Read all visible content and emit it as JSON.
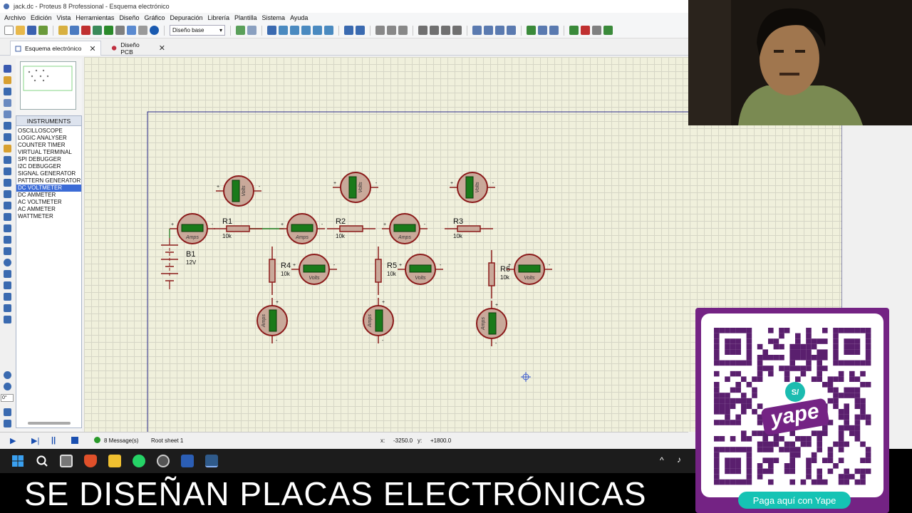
{
  "window": {
    "title": "jack.dc - Proteus 8 Professional - Esquema electrónico"
  },
  "menu": {
    "items": [
      "Archivo",
      "Edición",
      "Vista",
      "Herramientas",
      "Diseño",
      "Gráfico",
      "Depuración",
      "Librería",
      "Plantilla",
      "Sistema",
      "Ayuda"
    ]
  },
  "toolbar": {
    "variant_select": "Diseño base"
  },
  "tabs": [
    {
      "label": "Esquema electrónico",
      "active": true
    },
    {
      "label": "Diseño PCB",
      "active": false
    }
  ],
  "instruments": {
    "header": "INSTRUMENTS",
    "items": [
      "OSCILLOSCOPE",
      "LOGIC ANALYSER",
      "COUNTER TIMER",
      "VIRTUAL TERMINAL",
      "SPI DEBUGGER",
      "I2C DEBUGGER",
      "SIGNAL GENERATOR",
      "PATTERN GENERATOR",
      "DC VOLTMETER",
      "DC AMMETER",
      "AC VOLTMETER",
      "AC AMMETER",
      "WATTMETER"
    ],
    "selected": "DC VOLTMETER"
  },
  "schematic": {
    "battery": {
      "ref": "B1",
      "value": "12V"
    },
    "resistors": [
      {
        "ref": "R1",
        "value": "10k"
      },
      {
        "ref": "R2",
        "value": "10k"
      },
      {
        "ref": "R3",
        "value": "10k"
      },
      {
        "ref": "R4",
        "value": "10k"
      },
      {
        "ref": "R5",
        "value": "10k"
      },
      {
        "ref": "R6",
        "value": "10k"
      }
    ],
    "meter_labels": {
      "amps": "Amps",
      "volts": "Volts"
    },
    "meter_sign_plus": "+",
    "meter_sign_minus": "-",
    "colors": {
      "wire": "#8b1a1a",
      "meter_body": "#c9a99a",
      "meter_display": "#1a7a1a",
      "canvas": "#f0f0dc"
    }
  },
  "statusbar": {
    "messages": "8 Message(s)",
    "sheet": "Root sheet 1",
    "x_label": "x:",
    "x_value": "-3250.0",
    "y_label": "y:",
    "y_value": "+1800.0",
    "rotation": "0°"
  },
  "overlay": {
    "subtitle": "SE DISEÑAN PLACAS ELECTRÓNICAS",
    "payment_button": "Paga aquí con Yape",
    "brand_logo_text": "yape",
    "currency_badge": "S/"
  }
}
